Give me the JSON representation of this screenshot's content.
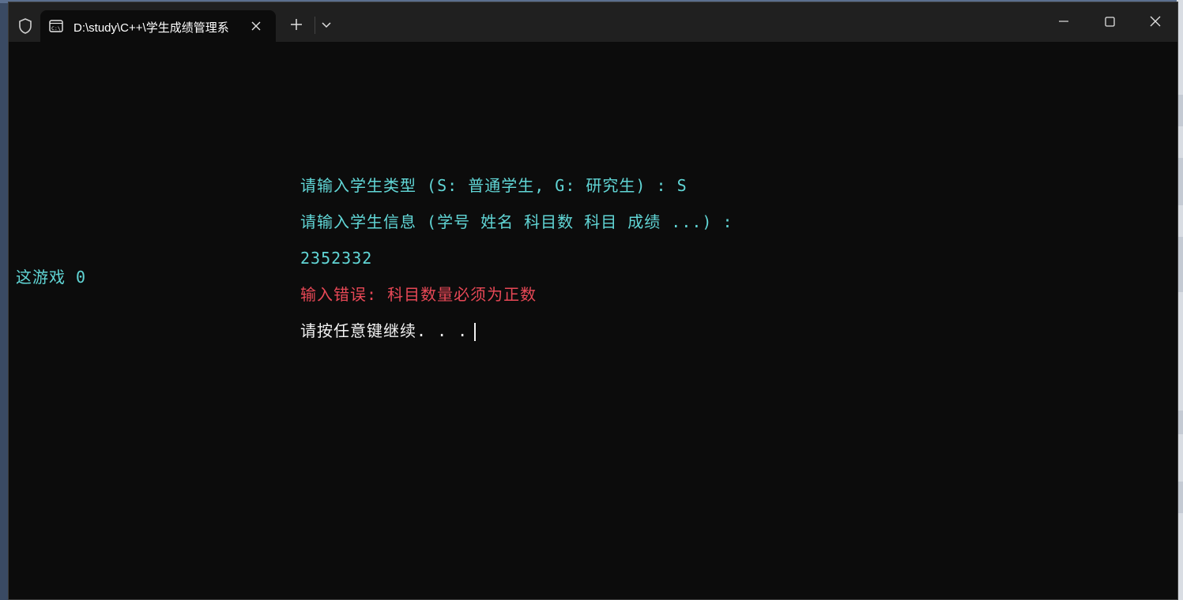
{
  "window": {
    "tab_title": "D:\\study\\C++\\学生成绩管理系",
    "icons": {
      "shield": "shield-icon",
      "terminal": "terminal-icon",
      "close_tab": "close-icon",
      "new_tab": "plus-icon",
      "dropdown": "chevron-down-icon",
      "minimize": "minimize-icon",
      "maximize": "maximize-icon",
      "close": "close-icon"
    }
  },
  "console": {
    "side_text": "这游戏 0",
    "lines": [
      {
        "text": "请输入学生类型 (S: 普通学生, G: 研究生) : S",
        "color": "#61d6d6"
      },
      {
        "text": "请输入学生信息 (学号 姓名 科目数 科目 成绩 ...) :",
        "color": "#61d6d6"
      },
      {
        "text": "2352332",
        "color": "#61d6d6"
      },
      {
        "text": "输入错误: 科目数量必须为正数",
        "color": "#e74856"
      },
      {
        "text": "请按任意键继续. . .",
        "color": "#f2f2f2"
      }
    ]
  },
  "colors": {
    "background": "#0c0c0c",
    "titlebar": "#202020",
    "cyan": "#61d6d6",
    "red": "#e74856",
    "white": "#f2f2f2"
  }
}
